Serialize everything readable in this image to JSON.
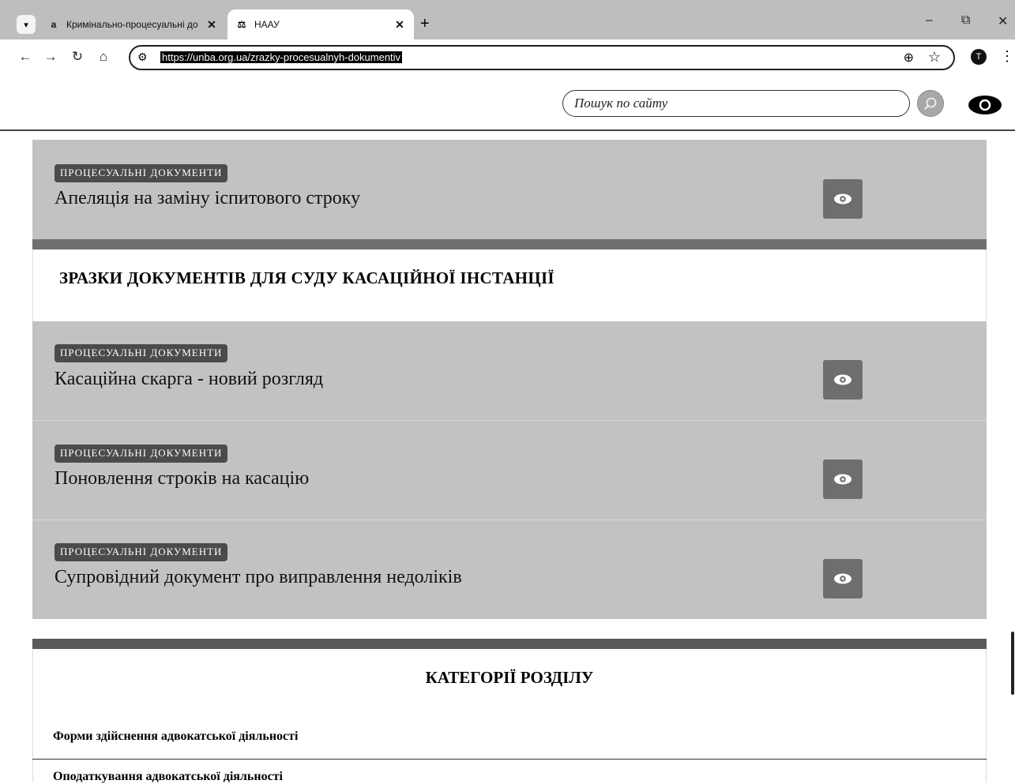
{
  "browser": {
    "tabs": [
      {
        "title": "Кримінально-процесуальні до",
        "active": false,
        "favicon": "a"
      },
      {
        "title": "НААУ",
        "active": true,
        "favicon": "⚖"
      }
    ],
    "new_tab": "+",
    "url": "https://unba.org.ua/zrazky-procesualnyh-dokumentiv",
    "profile_initial": "T",
    "window_controls": {
      "minimize": "–",
      "maximize": "⧉",
      "close": "✕"
    }
  },
  "header": {
    "search_placeholder": "Пошук по сайту",
    "search_icon": "search-icon",
    "accessibility_icon": "eye-icon"
  },
  "documents_top": [
    {
      "category": "ПРОЦЕСУАЛЬНІ ДОКУМЕНТИ",
      "title": "Апеляція на заміну іспитового строку"
    }
  ],
  "section_cassation": {
    "heading": "ЗРАЗКИ ДОКУМЕНТІВ ДЛЯ СУДУ КАСАЦІЙНОЇ ІНСТАНЦІЇ",
    "documents": [
      {
        "category": "ПРОЦЕСУАЛЬНІ ДОКУМЕНТИ",
        "title": "Касаційна скарга - новий розгляд"
      },
      {
        "category": "ПРОЦЕСУАЛЬНІ ДОКУМЕНТИ",
        "title": "Поновлення строків на касацію"
      },
      {
        "category": "ПРОЦЕСУАЛЬНІ ДОКУМЕНТИ",
        "title": "Супровідний документ про виправлення недоліків"
      }
    ]
  },
  "categories": {
    "heading": "КАТЕГОРІЇ РОЗДІЛУ",
    "items": [
      "Форми здійснення адвокатської діяльності",
      "Оподаткування адвокатської діяльності"
    ]
  },
  "colors": {
    "card_bg": "#c2c2c2",
    "badge_bg": "#4b4b4b",
    "view_button_bg": "#6e6e6e"
  }
}
